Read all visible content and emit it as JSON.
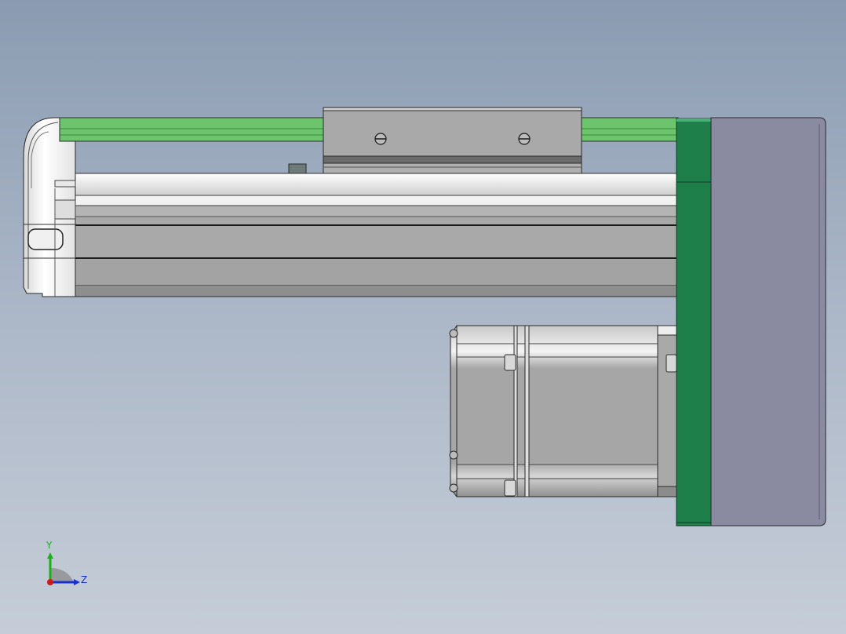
{
  "viewport": {
    "background_top": "#8a9bb1",
    "background_bottom": "#c6cdd8"
  },
  "colors": {
    "belt_green": "#6cc46c",
    "plate_green": "#1f7f4a",
    "cover_purple": "#8a8aa0",
    "body_gray": "#a9a9a9",
    "highlight_white": "#f2f2f2"
  },
  "model": {
    "parts": [
      "end-cap",
      "belt",
      "carriage",
      "rail-body",
      "motor-plate",
      "side-cover",
      "stepper-motor"
    ]
  },
  "triad": {
    "y_label": "Y",
    "z_label": "Z",
    "y_color": "#1bb01b",
    "z_color": "#1a2fd0",
    "origin_color": "#d01a1a"
  }
}
